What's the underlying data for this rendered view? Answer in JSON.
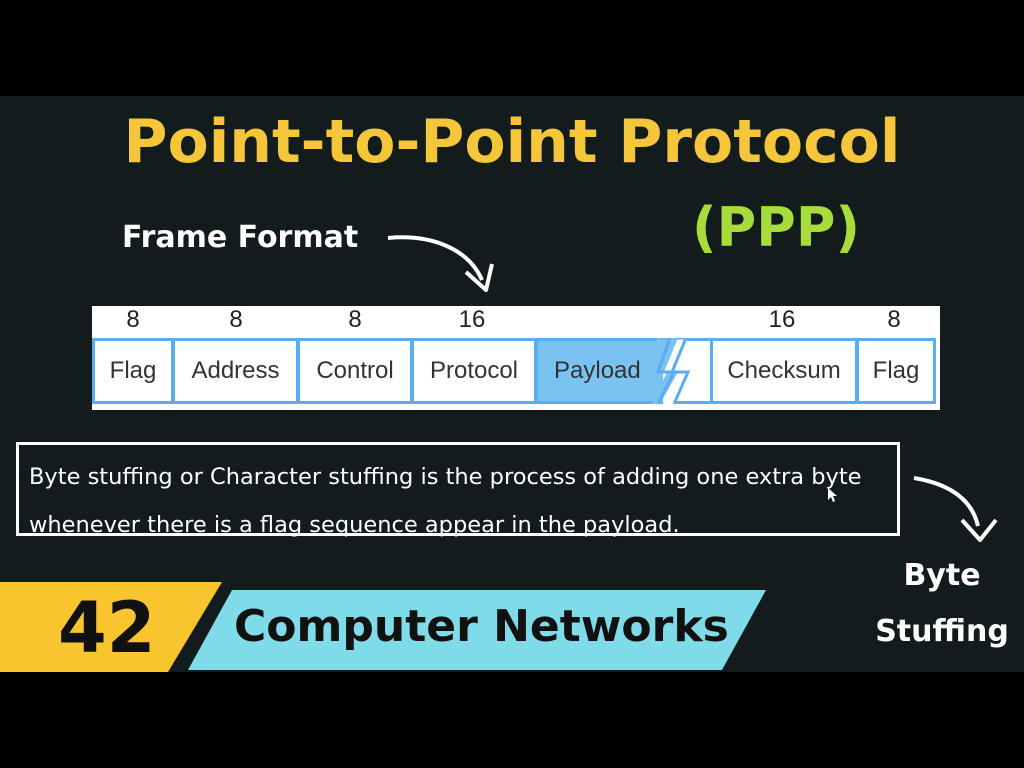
{
  "title": "Point-to-Point Protocol",
  "subtitle": "(PPP)",
  "frame_format_label": "Frame Format",
  "frame": {
    "fields": [
      {
        "name": "Flag",
        "bits": "8"
      },
      {
        "name": "Address",
        "bits": "8"
      },
      {
        "name": "Control",
        "bits": "8"
      },
      {
        "name": "Protocol",
        "bits": "16"
      },
      {
        "name": "Payload",
        "bits": ""
      },
      {
        "name": "Checksum",
        "bits": "16"
      },
      {
        "name": "Flag",
        "bits": "8"
      }
    ]
  },
  "definition": {
    "line1": "Byte stuffing or Character stuffing is the process of adding one extra byte",
    "line2": "whenever there is a flag sequence appear in the payload."
  },
  "byte_stuffing_label": {
    "line1": "Byte",
    "line2": "Stuffing"
  },
  "episode": {
    "number": "42",
    "series": "Computer Networks"
  },
  "colors": {
    "background": "#121c1d",
    "title": "#f6c63a",
    "subtitle": "#a8dc3c",
    "field_border": "#5aaef0",
    "payload_fill": "#79c3f3",
    "badge_yellow": "#f8c52e",
    "banner_cyan": "#7fdbe7"
  }
}
